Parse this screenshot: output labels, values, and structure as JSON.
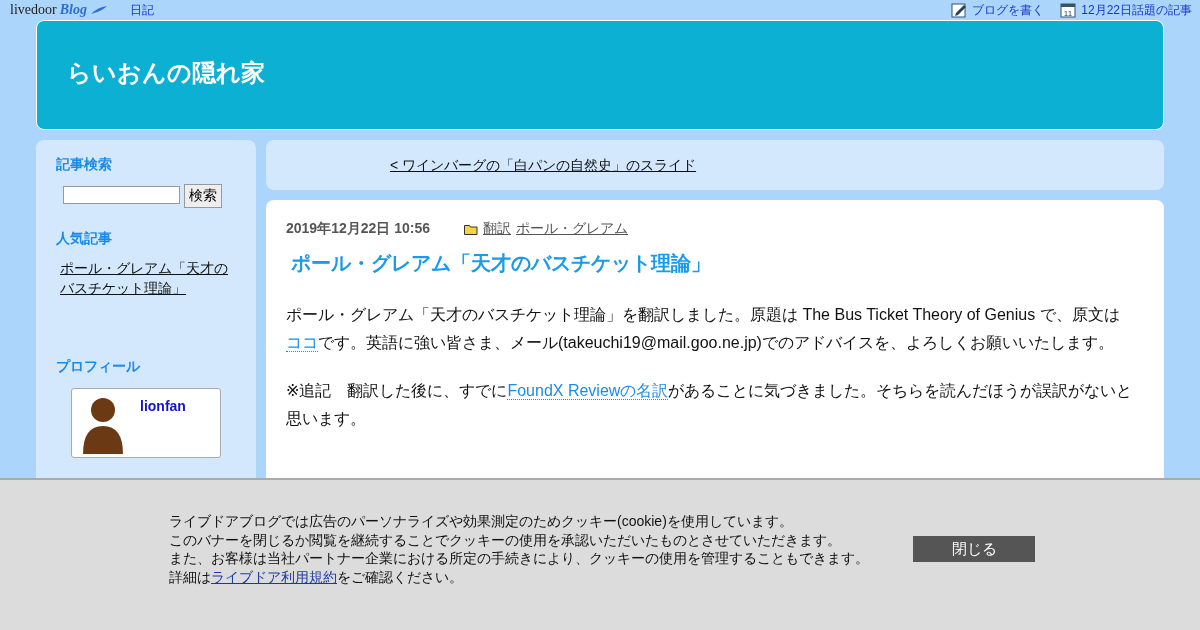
{
  "topbar": {
    "logo": "livedoor",
    "logo_script": "Blog",
    "category": "日記",
    "links": [
      {
        "kind": "write",
        "text": "ブログを書く"
      },
      {
        "kind": "calendar",
        "icon_text": "11",
        "text": "12月22日話題の記事"
      }
    ]
  },
  "header": {
    "title": "らいおんの隠れ家"
  },
  "sidebar": {
    "search_heading": "記事検索",
    "search_button": "検索",
    "popular_heading": "人気記事",
    "popular": [
      "ポール・グレアム「天才のバスチケット理論」"
    ],
    "profile_heading": "プロフィール",
    "profile_name": "lionfan"
  },
  "nav": {
    "prev_link": "< ワインバーグの「白パンの自然史」のスライド"
  },
  "article": {
    "date": "2019年12月22日 10:56",
    "categories": [
      "翻訳",
      "ポール・グレアム"
    ],
    "title": "ポール・グレアム「天才のバスチケット理論」",
    "paragraphs": [
      [
        {
          "text": "ポール・グレアム「天才のバスチケット理論」を翻訳しました。原題は The Bus Ticket Theory of Genius で、原文は",
          "link": false
        },
        {
          "text": "ココ",
          "link": true
        },
        {
          "text": "です。英語に強い皆さま、メール(takeuchi19@mail.goo.ne.jp)でのアドバイスを、よろしくお願いいたします。",
          "link": false
        }
      ],
      [
        {
          "text": "※追記　翻訳した後に、すでに",
          "link": false
        },
        {
          "text": "FoundX Reviewの名訳",
          "link": true
        },
        {
          "text": "があることに気づきました。そちらを読んだほうが誤訳がないと思います。",
          "link": false
        }
      ]
    ]
  },
  "cookie_banner": {
    "lines": [
      [
        {
          "text": "ライブドアブログでは広告のパーソナライズや効果測定のためクッキー(cookie)を使用しています。",
          "link": false
        }
      ],
      [
        {
          "text": "このバナーを閉じるか閲覧を継続することでクッキーの使用を承認いただいたものとさせていただきます。",
          "link": false
        }
      ],
      [
        {
          "text": "また、お客様は当社パートナー企業における所定の手続きにより、クッキーの使用を管理することもできます。",
          "link": false
        }
      ],
      [
        {
          "text": "詳細は",
          "link": false
        },
        {
          "text": "ライブドア利用規約",
          "link": true
        },
        {
          "text": "をご確認ください。",
          "link": false
        }
      ]
    ],
    "close_button": "閉じる"
  }
}
